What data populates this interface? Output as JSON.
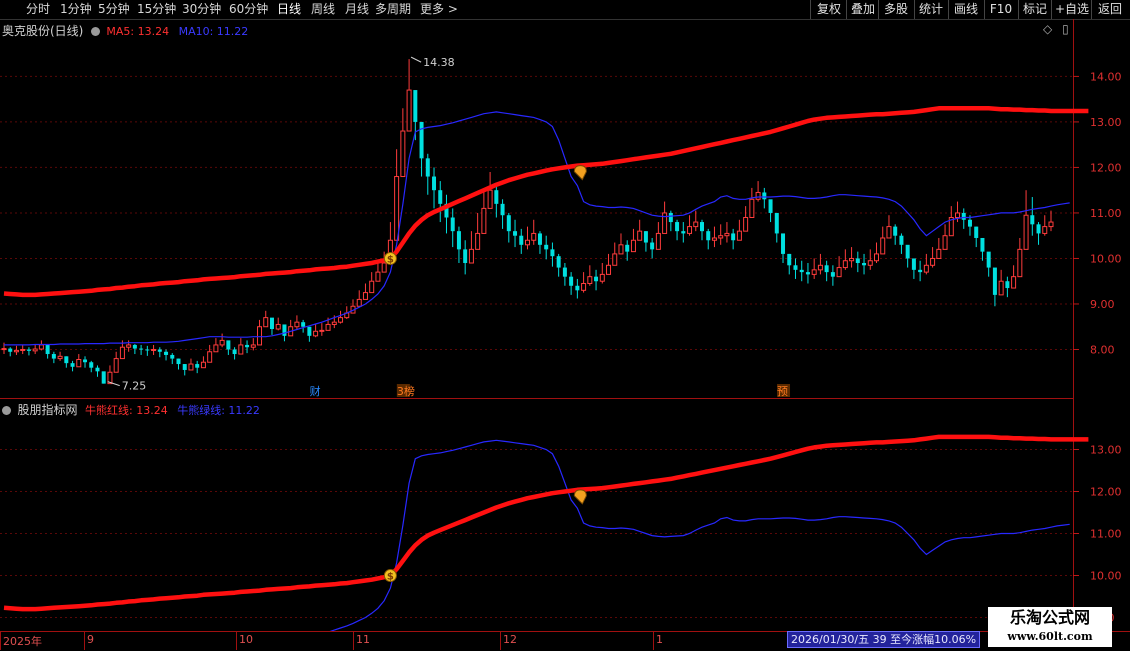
{
  "toolbar": {
    "periods": [
      "分时",
      "1分钟",
      "5分钟",
      "15分钟",
      "30分钟",
      "60分钟",
      "日线",
      "周线",
      "月线",
      "多周期",
      "更多 >"
    ],
    "active_period": "日线",
    "right_buttons": [
      "复权",
      "叠加",
      "多股",
      "统计",
      "画线",
      "F10",
      "标记",
      "+自选",
      "返回"
    ]
  },
  "main_panel": {
    "title": "奥克股份(日线)",
    "ma5_label": "MA5: 13.24",
    "ma10_label": "MA10: 11.22",
    "max_price_label": "14.38",
    "min_price_label": "7.25",
    "event_tags": [
      "财",
      "3榜",
      "预"
    ],
    "yticks": [
      8.0,
      9.0,
      10.0,
      11.0,
      12.0,
      13.0,
      14.0
    ],
    "colors": {
      "ma5": "#ff1010",
      "ma10": "#2828ff",
      "up": "#ff3c3c",
      "down": "#00e0e0"
    }
  },
  "sub_panel": {
    "title": "股朋指标网",
    "red_label": "牛熊红线: 13.24",
    "blue_label": "牛熊绿线: 11.22",
    "yticks": [
      9.0,
      10.0,
      11.0,
      12.0,
      13.0
    ]
  },
  "timeline": [
    "2025年",
    "9",
    "10",
    "11",
    "12",
    "1"
  ],
  "status_text": "2026/01/30/五 39 至今涨幅10.06%",
  "watermark": {
    "line1": "乐淘公式网",
    "line2": "www.60lt.com"
  },
  "chart_data": {
    "type": "candlestick",
    "x_start": "2025年",
    "x_end": "2026/01/30",
    "closes": [
      8.02,
      7.95,
      7.98,
      8.0,
      7.97,
      8.01,
      8.1,
      7.9,
      7.8,
      7.85,
      7.7,
      7.62,
      7.78,
      7.72,
      7.6,
      7.52,
      7.25,
      7.5,
      7.8,
      8.05,
      8.1,
      8.02,
      8.0,
      7.98,
      8.0,
      7.95,
      7.88,
      7.8,
      7.68,
      7.55,
      7.68,
      7.6,
      7.72,
      7.95,
      8.1,
      8.2,
      8.0,
      7.9,
      8.1,
      8.05,
      8.1,
      8.5,
      8.7,
      8.45,
      8.55,
      8.3,
      8.5,
      8.6,
      8.5,
      8.3,
      8.4,
      8.42,
      8.55,
      8.6,
      8.7,
      8.8,
      8.95,
      9.1,
      9.25,
      9.5,
      9.7,
      9.9,
      10.4,
      11.8,
      12.8,
      13.7,
      13.0,
      12.2,
      11.8,
      11.5,
      11.2,
      10.9,
      10.6,
      10.2,
      9.9,
      10.2,
      10.55,
      11.1,
      11.5,
      11.2,
      10.95,
      10.6,
      10.5,
      10.3,
      10.4,
      10.55,
      10.3,
      10.2,
      10.05,
      9.8,
      9.6,
      9.4,
      9.3,
      9.45,
      9.6,
      9.5,
      9.65,
      9.85,
      10.1,
      10.3,
      10.15,
      10.4,
      10.6,
      10.35,
      10.2,
      10.55,
      11.0,
      10.8,
      10.6,
      10.55,
      10.7,
      10.8,
      10.6,
      10.4,
      10.45,
      10.5,
      10.55,
      10.4,
      10.6,
      10.9,
      11.3,
      11.45,
      11.3,
      11.0,
      10.55,
      10.1,
      9.85,
      9.75,
      9.7,
      9.65,
      9.75,
      9.85,
      9.7,
      9.6,
      9.8,
      9.95,
      10.0,
      9.9,
      9.85,
      9.95,
      10.1,
      10.45,
      10.7,
      10.5,
      10.3,
      10.0,
      9.75,
      9.7,
      9.85,
      10.0,
      10.2,
      10.5,
      10.9,
      11.0,
      10.85,
      10.7,
      10.45,
      10.15,
      9.8,
      9.2,
      9.5,
      9.35,
      9.6,
      10.2,
      10.95,
      10.75,
      10.55,
      10.7,
      10.8
    ],
    "highs": [
      8.15,
      8.05,
      8.08,
      8.1,
      8.05,
      8.12,
      8.2,
      8.05,
      7.95,
      7.95,
      7.85,
      7.75,
      7.9,
      7.85,
      7.75,
      7.65,
      7.4,
      7.65,
      7.95,
      8.2,
      8.2,
      8.12,
      8.1,
      8.08,
      8.1,
      8.05,
      8.0,
      7.92,
      7.8,
      7.68,
      7.8,
      7.75,
      7.85,
      8.1,
      8.25,
      8.35,
      8.15,
      8.05,
      8.25,
      8.2,
      8.25,
      8.65,
      8.85,
      8.6,
      8.7,
      8.45,
      8.65,
      8.75,
      8.65,
      8.45,
      8.55,
      8.58,
      8.7,
      8.75,
      8.85,
      8.95,
      9.1,
      9.3,
      9.45,
      9.7,
      9.9,
      10.15,
      10.8,
      12.4,
      13.3,
      14.38,
      13.6,
      12.8,
      12.3,
      12.0,
      11.7,
      11.4,
      11.1,
      10.7,
      10.4,
      10.6,
      11.0,
      11.5,
      11.9,
      11.6,
      11.3,
      11.0,
      10.85,
      10.65,
      10.7,
      10.85,
      10.6,
      10.5,
      10.35,
      10.1,
      9.9,
      9.7,
      9.55,
      9.7,
      9.85,
      9.75,
      9.9,
      10.1,
      10.35,
      10.55,
      10.4,
      10.65,
      10.85,
      10.6,
      10.45,
      10.8,
      11.25,
      11.05,
      10.85,
      10.8,
      10.95,
      11.05,
      10.85,
      10.65,
      10.7,
      10.75,
      10.8,
      10.65,
      10.85,
      11.15,
      11.55,
      11.7,
      11.55,
      11.25,
      10.8,
      10.35,
      10.1,
      10.0,
      9.95,
      9.9,
      10.0,
      10.1,
      9.95,
      9.85,
      10.05,
      10.2,
      10.25,
      10.15,
      10.1,
      10.2,
      10.35,
      10.7,
      10.95,
      10.75,
      10.55,
      10.25,
      10.0,
      9.95,
      10.1,
      10.25,
      10.45,
      10.75,
      11.15,
      11.25,
      11.1,
      10.95,
      10.7,
      10.4,
      10.05,
      9.5,
      9.75,
      9.6,
      9.85,
      10.45,
      11.5,
      11.35,
      10.8,
      10.95,
      11.05
    ],
    "lows": [
      7.9,
      7.85,
      7.88,
      7.9,
      7.87,
      7.9,
      7.98,
      7.8,
      7.7,
      7.75,
      7.6,
      7.52,
      7.65,
      7.6,
      7.5,
      7.4,
      7.25,
      7.38,
      7.65,
      7.9,
      7.95,
      7.9,
      7.88,
      7.86,
      7.88,
      7.83,
      7.76,
      7.68,
      7.56,
      7.43,
      7.55,
      7.48,
      7.6,
      7.82,
      7.97,
      8.05,
      7.88,
      7.78,
      7.95,
      7.92,
      7.98,
      8.35,
      8.55,
      8.32,
      8.42,
      8.18,
      8.35,
      8.45,
      8.37,
      8.17,
      8.27,
      8.3,
      8.42,
      8.47,
      8.57,
      8.67,
      8.82,
      8.95,
      9.1,
      9.33,
      9.52,
      9.7,
      10.1,
      11.3,
      12.3,
      13.1,
      12.6,
      11.8,
      11.4,
      11.1,
      10.8,
      10.55,
      10.25,
      9.9,
      9.65,
      9.95,
      10.3,
      10.8,
      11.15,
      10.9,
      10.65,
      10.35,
      10.25,
      10.1,
      10.2,
      10.3,
      10.1,
      9.98,
      9.82,
      9.6,
      9.4,
      9.2,
      9.12,
      9.25,
      9.4,
      9.3,
      9.45,
      9.65,
      9.9,
      10.1,
      9.95,
      10.2,
      10.4,
      10.15,
      10.0,
      10.35,
      10.8,
      10.6,
      10.4,
      10.35,
      10.5,
      10.6,
      10.4,
      10.2,
      10.25,
      10.3,
      10.35,
      10.2,
      10.4,
      10.7,
      11.1,
      11.25,
      11.1,
      10.8,
      10.35,
      9.9,
      9.65,
      9.55,
      9.5,
      9.45,
      9.55,
      9.65,
      9.5,
      9.4,
      9.6,
      9.75,
      9.8,
      9.7,
      9.65,
      9.75,
      9.9,
      10.25,
      10.5,
      10.3,
      10.1,
      9.8,
      9.55,
      9.5,
      9.65,
      9.8,
      10.0,
      10.3,
      10.7,
      10.8,
      10.65,
      10.5,
      10.25,
      9.95,
      9.6,
      8.95,
      9.3,
      9.15,
      9.4,
      10.0,
      10.75,
      10.5,
      10.3,
      10.5,
      10.6
    ],
    "series": [
      {
        "name": "MA5",
        "values": [
          9.23,
          9.22,
          9.21,
          9.2,
          9.2,
          9.2,
          9.21,
          9.22,
          9.23,
          9.24,
          9.25,
          9.26,
          9.27,
          9.28,
          9.29,
          9.31,
          9.32,
          9.33,
          9.35,
          9.36,
          9.38,
          9.39,
          9.41,
          9.42,
          9.43,
          9.45,
          9.46,
          9.47,
          9.48,
          9.5,
          9.51,
          9.52,
          9.54,
          9.55,
          9.56,
          9.57,
          9.58,
          9.59,
          9.61,
          9.62,
          9.63,
          9.64,
          9.66,
          9.67,
          9.68,
          9.69,
          9.7,
          9.72,
          9.73,
          9.74,
          9.76,
          9.77,
          9.78,
          9.79,
          9.81,
          9.82,
          9.84,
          9.86,
          9.88,
          9.9,
          9.93,
          9.96,
          10.0,
          10.15,
          10.35,
          10.55,
          10.72,
          10.85,
          10.95,
          11.02,
          11.08,
          11.14,
          11.2,
          11.26,
          11.32,
          11.38,
          11.44,
          11.5,
          11.56,
          11.62,
          11.67,
          11.72,
          11.76,
          11.8,
          11.84,
          11.87,
          11.9,
          11.93,
          11.96,
          11.98,
          12.0,
          12.02,
          12.04,
          12.05,
          12.06,
          12.07,
          12.08,
          12.1,
          12.12,
          12.14,
          12.16,
          12.18,
          12.2,
          12.22,
          12.24,
          12.26,
          12.28,
          12.3,
          12.33,
          12.36,
          12.39,
          12.42,
          12.45,
          12.48,
          12.51,
          12.54,
          12.57,
          12.6,
          12.63,
          12.66,
          12.69,
          12.72,
          12.75,
          12.78,
          12.82,
          12.86,
          12.9,
          12.94,
          12.98,
          13.02,
          13.05,
          13.07,
          13.09,
          13.1,
          13.11,
          13.12,
          13.13,
          13.14,
          13.15,
          13.16,
          13.17,
          13.17,
          13.18,
          13.19,
          13.2,
          13.21,
          13.22,
          13.24,
          13.26,
          13.28,
          13.3,
          13.3,
          13.3,
          13.3,
          13.3,
          13.3,
          13.3,
          13.3,
          13.3,
          13.29,
          13.28,
          13.28,
          13.27,
          13.27,
          13.26,
          13.26,
          13.25,
          13.25,
          13.24,
          13.24,
          13.24,
          13.24,
          13.24,
          13.24,
          13.24
        ]
      },
      {
        "name": "MA10",
        "values": [
          8.1,
          8.1,
          8.1,
          8.1,
          8.1,
          8.11,
          8.11,
          8.11,
          8.11,
          8.12,
          8.12,
          8.12,
          8.12,
          8.13,
          8.13,
          8.13,
          8.13,
          8.14,
          8.14,
          8.14,
          8.15,
          8.15,
          8.15,
          8.15,
          8.16,
          8.16,
          8.16,
          8.17,
          8.18,
          8.2,
          8.22,
          8.24,
          8.26,
          8.28,
          8.28,
          8.28,
          8.27,
          8.27,
          8.27,
          8.27,
          8.28,
          8.28,
          8.28,
          8.3,
          8.33,
          8.36,
          8.4,
          8.44,
          8.48,
          8.52,
          8.56,
          8.6,
          8.65,
          8.7,
          8.75,
          8.8,
          8.86,
          8.93,
          9.0,
          9.1,
          9.22,
          9.4,
          9.7,
          10.3,
          11.2,
          12.2,
          12.78,
          12.85,
          12.88,
          12.9,
          12.92,
          12.95,
          12.98,
          13.02,
          13.06,
          13.1,
          13.14,
          13.18,
          13.2,
          13.22,
          13.2,
          13.18,
          13.16,
          13.14,
          13.12,
          13.1,
          13.05,
          13.0,
          12.9,
          12.6,
          12.2,
          11.8,
          11.6,
          11.25,
          11.18,
          11.15,
          11.14,
          11.12,
          11.12,
          11.13,
          11.12,
          11.1,
          11.05,
          11.0,
          10.95,
          10.93,
          10.92,
          10.93,
          10.94,
          10.95,
          11.0,
          11.08,
          11.15,
          11.2,
          11.25,
          11.35,
          11.38,
          11.32,
          11.3,
          11.3,
          11.33,
          11.35,
          11.35,
          11.35,
          11.36,
          11.37,
          11.37,
          11.36,
          11.34,
          11.32,
          11.32,
          11.33,
          11.35,
          11.38,
          11.4,
          11.4,
          11.39,
          11.38,
          11.37,
          11.36,
          11.35,
          11.33,
          11.3,
          11.25,
          11.15,
          11.0,
          10.85,
          10.65,
          10.5,
          10.6,
          10.7,
          10.8,
          10.85,
          10.88,
          10.9,
          10.9,
          10.92,
          10.94,
          10.96,
          10.98,
          11.0,
          11.0,
          11.0,
          11.02,
          11.05,
          11.08,
          11.1,
          11.12,
          11.15,
          11.18,
          11.2,
          11.22
        ]
      }
    ],
    "ylim": [
      7.0,
      14.8
    ],
    "sub_ylim": [
      8.75,
      13.75
    ]
  }
}
